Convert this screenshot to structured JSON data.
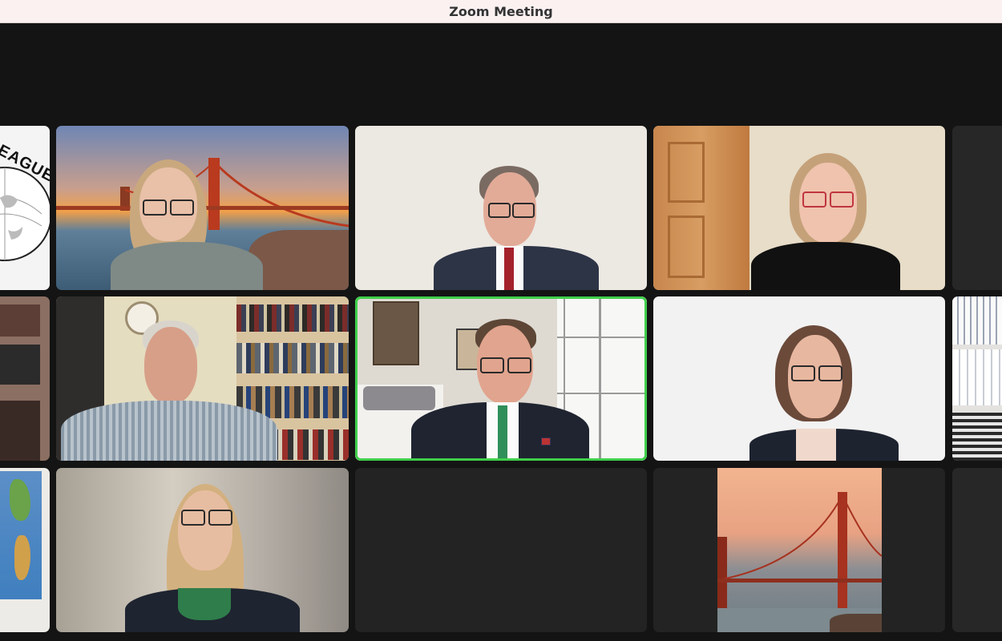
{
  "window": {
    "title": "Zoom Meeting"
  },
  "participants": [
    {
      "id": "p-league-logo",
      "logo_text": "EAGUE"
    },
    {
      "id": "p-woman-golden-gate"
    },
    {
      "id": "p-man-red-tie"
    },
    {
      "id": "p-woman-wood-door"
    },
    {
      "id": "p-left-edge-room"
    },
    {
      "id": "p-elderly-man-bookshelf"
    },
    {
      "id": "p-active-speaker",
      "active": true
    },
    {
      "id": "p-woman-white-wall"
    },
    {
      "id": "p-right-edge-files"
    },
    {
      "id": "p-left-edge-map"
    },
    {
      "id": "p-woman-blurred-room"
    },
    {
      "id": "p-empty-tile"
    },
    {
      "id": "p-golden-gate-image"
    },
    {
      "id": "p-right-edge-empty"
    }
  ],
  "colors": {
    "active_border": "#3fcf4b",
    "stage_background": "#141414",
    "titlebar_background": "#fbf1f1"
  }
}
